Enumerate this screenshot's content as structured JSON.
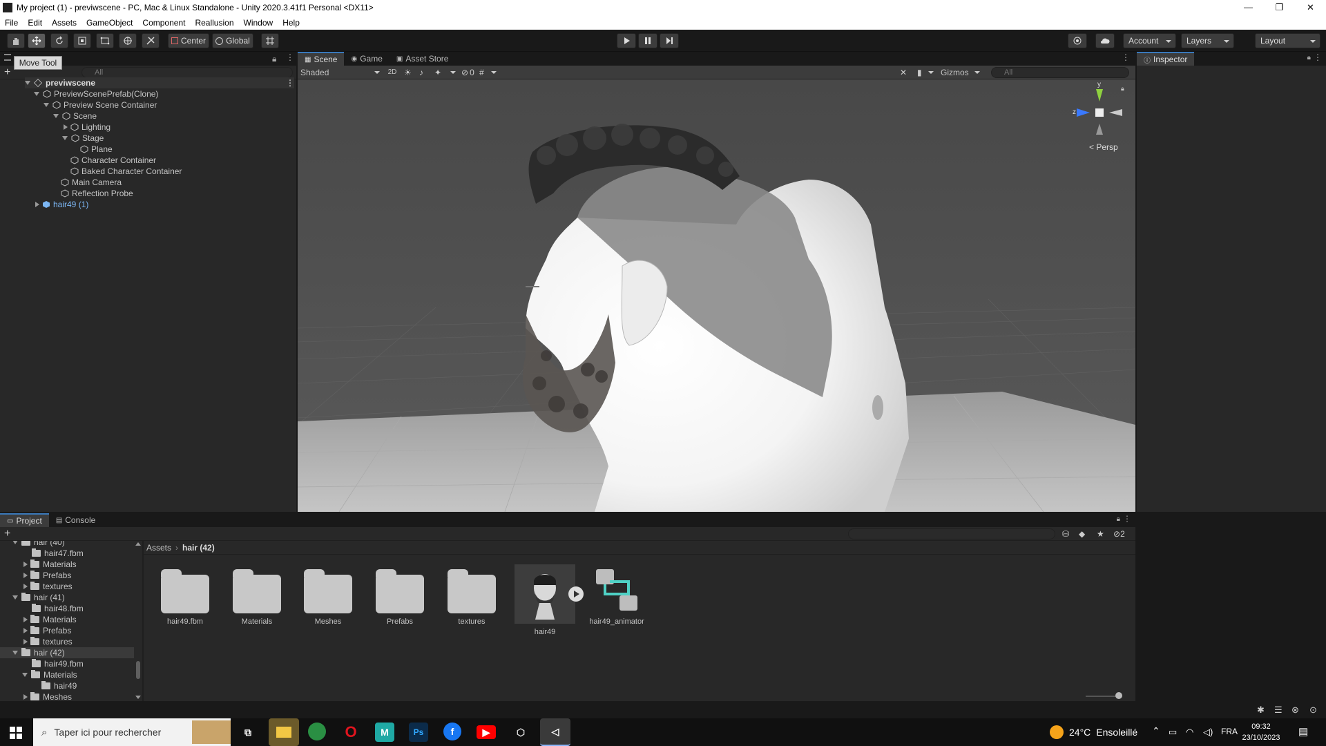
{
  "window": {
    "title": "My project (1) - previwscene - PC, Mac & Linux Standalone - Unity 2020.3.41f1 Personal <DX11>",
    "minimize": "—",
    "restore": "❐",
    "close": "✕"
  },
  "menu": [
    "File",
    "Edit",
    "Assets",
    "GameObject",
    "Component",
    "Reallusion",
    "Window",
    "Help"
  ],
  "toolbar": {
    "pivot_label": "Center",
    "space_label": "Global",
    "account_label": "Account",
    "layers_label": "Layers",
    "layout_label": "Layout",
    "tooltip": "Move Tool"
  },
  "hierarchy": {
    "search_placeholder": "All",
    "root": "previwscene",
    "items": [
      {
        "label": "PreviewScenePrefab(Clone)"
      },
      {
        "label": "Preview Scene Container"
      },
      {
        "label": "Scene"
      },
      {
        "label": "Lighting"
      },
      {
        "label": "Stage"
      },
      {
        "label": "Plane"
      },
      {
        "label": "Character Container"
      },
      {
        "label": "Baked Character Container"
      },
      {
        "label": "Main Camera"
      },
      {
        "label": "Reflection Probe"
      },
      {
        "label": "hair49 (1)"
      }
    ]
  },
  "scene": {
    "tabs": [
      "Scene",
      "Game",
      "Asset Store"
    ],
    "shading": "Shaded",
    "mode_2d": "2D",
    "hidden_count": "0",
    "gizmos_label": "Gizmos",
    "search_placeholder": "All",
    "gizmo_y": "y",
    "gizmo_z": "z",
    "persp_label": "< Persp"
  },
  "inspector": {
    "tab": "Inspector"
  },
  "project": {
    "tabs": [
      "Project",
      "Console"
    ],
    "hidden_count": "2",
    "breadcrumb": [
      "Assets",
      "hair (42)"
    ],
    "tree": [
      {
        "label": "hair (40)"
      },
      {
        "label": "hair47.fbm"
      },
      {
        "label": "Materials"
      },
      {
        "label": "Prefabs"
      },
      {
        "label": "textures"
      },
      {
        "label": "hair (41)"
      },
      {
        "label": "hair48.fbm"
      },
      {
        "label": "Materials"
      },
      {
        "label": "Prefabs"
      },
      {
        "label": "textures"
      },
      {
        "label": "hair (42)"
      },
      {
        "label": "hair49.fbm"
      },
      {
        "label": "Materials"
      },
      {
        "label": "hair49"
      },
      {
        "label": "Meshes"
      }
    ],
    "assets": [
      {
        "label": "hair49.fbm"
      },
      {
        "label": "Materials"
      },
      {
        "label": "Meshes"
      },
      {
        "label": "Prefabs"
      },
      {
        "label": "textures"
      },
      {
        "label": "hair49"
      },
      {
        "label": "hair49_animator"
      }
    ]
  },
  "taskbar": {
    "search_placeholder": "Taper ici pour rechercher",
    "weather_temp": "24°C",
    "weather_desc": "Ensoleillé",
    "language": "FRA",
    "time": "09:32",
    "date": "23/10/2023"
  },
  "colors": {
    "accent": "#3a79bb",
    "prefab_blue": "#7cb7f5",
    "selection": "#2c5d87"
  }
}
